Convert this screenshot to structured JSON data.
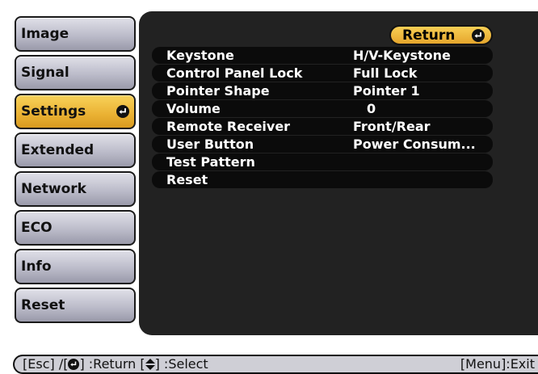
{
  "sidebar": {
    "items": [
      {
        "label": "Image"
      },
      {
        "label": "Signal"
      },
      {
        "label": "Settings",
        "active": true
      },
      {
        "label": "Extended"
      },
      {
        "label": "Network"
      },
      {
        "label": "ECO"
      },
      {
        "label": "Info"
      },
      {
        "label": "Reset"
      }
    ]
  },
  "panel": {
    "return_label": "Return",
    "rows": [
      {
        "label": "Keystone",
        "value": "H/V-Keystone"
      },
      {
        "label": "Control Panel Lock",
        "value": "Full Lock"
      },
      {
        "label": "Pointer Shape",
        "value": "Pointer 1"
      },
      {
        "label": "Volume",
        "value": "0"
      },
      {
        "label": "Remote Receiver",
        "value": "Front/Rear"
      },
      {
        "label": "User Button",
        "value": "Power Consum..."
      },
      {
        "label": "Test Pattern",
        "value": ""
      },
      {
        "label": "Reset",
        "value": ""
      }
    ]
  },
  "footer": {
    "esc_label": "[Esc] /[",
    "return_label": "] :Return  [",
    "select_label": "] :Select",
    "menu_exit": "[Menu]:Exit"
  },
  "icons": {
    "enter": "enter-icon",
    "updown": "up-down-arrow-icon"
  },
  "colors": {
    "accent": "#eab133",
    "panel_bg": "#222222",
    "row_bg": "#0b0b0b",
    "sidebar_bg": "#bcbcca"
  }
}
